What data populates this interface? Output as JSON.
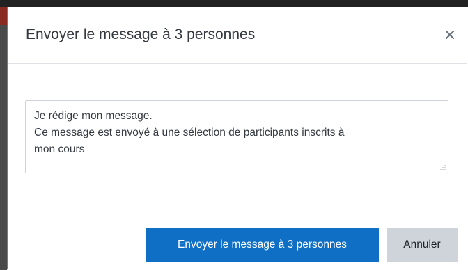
{
  "modal": {
    "title": "Envoyer le message à 3 personnes",
    "close_label": "×"
  },
  "message": {
    "lines": [
      "Je rédige mon message.",
      "Ce message est envoyé à une sélection de participants inscrits à",
      "mon cours"
    ]
  },
  "footer": {
    "send_label": "Envoyer le message à 3 personnes",
    "cancel_label": "Annuler"
  },
  "colors": {
    "primary": "#0f6fc5",
    "secondary": "#ced4da",
    "text": "#343a40"
  },
  "icons": {
    "close": "close-icon",
    "resize": "resize-grip-icon"
  }
}
